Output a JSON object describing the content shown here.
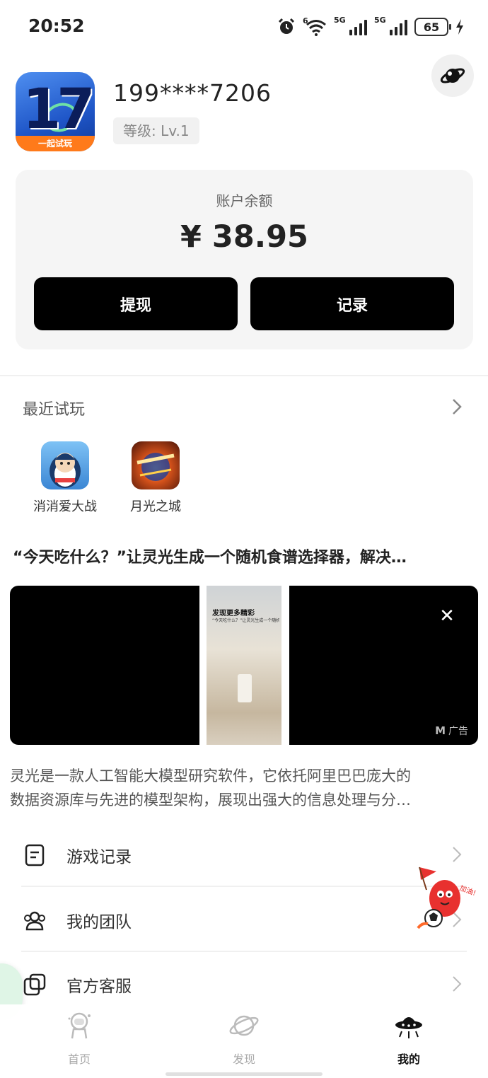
{
  "status_bar": {
    "time": "20:52",
    "icons": [
      "alarm-icon",
      "wifi-icon",
      "signal-5g-icon",
      "signal-5g-icon"
    ],
    "wifi_tag": "6",
    "sim1_tag": "5G",
    "sim2_tag": "5G",
    "battery": "65"
  },
  "profile": {
    "avatar_text": "17",
    "avatar_ribbon": "一起试玩",
    "phone": "199****7206",
    "level": "等级: Lv.1",
    "settings_icon": "settings-planet-icon"
  },
  "balance": {
    "label": "账户余额",
    "value": "¥ 38.95",
    "withdraw_label": "提现",
    "records_label": "记录"
  },
  "recent": {
    "title": "最近试玩",
    "games": [
      {
        "name": "消消爱大战",
        "icon": "penguin-game-icon"
      },
      {
        "name": "月光之城",
        "icon": "moon-city-game-icon"
      }
    ]
  },
  "article": {
    "title": "“今天吃什么？”让灵光生成一个随机食谱选择器，解决…",
    "ad": {
      "inner_title": "发现更多精彩",
      "inner_sub": "“今天吃什么？”让灵光生成一个随机食谱...",
      "label": "广告",
      "brand_mark": "M"
    },
    "desc_line1": "灵光是一款人工智能大模型研究软件，它依托阿里巴巴庞大的",
    "desc_line2": "数据资源库与先进的模型架构，展现出强大的信息处理与分…"
  },
  "menu": [
    {
      "label": "游戏记录",
      "icon": "document-icon"
    },
    {
      "label": "我的团队",
      "icon": "team-icon"
    },
    {
      "label": "官方客服",
      "icon": "customer-service-icon"
    }
  ],
  "mascot": {
    "text": "加油!"
  },
  "bottom_nav": [
    {
      "label": "首页",
      "icon": "astronaut-icon",
      "active": false
    },
    {
      "label": "发现",
      "icon": "planet-icon",
      "active": false
    },
    {
      "label": "我的",
      "icon": "ufo-icon",
      "active": true
    }
  ]
}
